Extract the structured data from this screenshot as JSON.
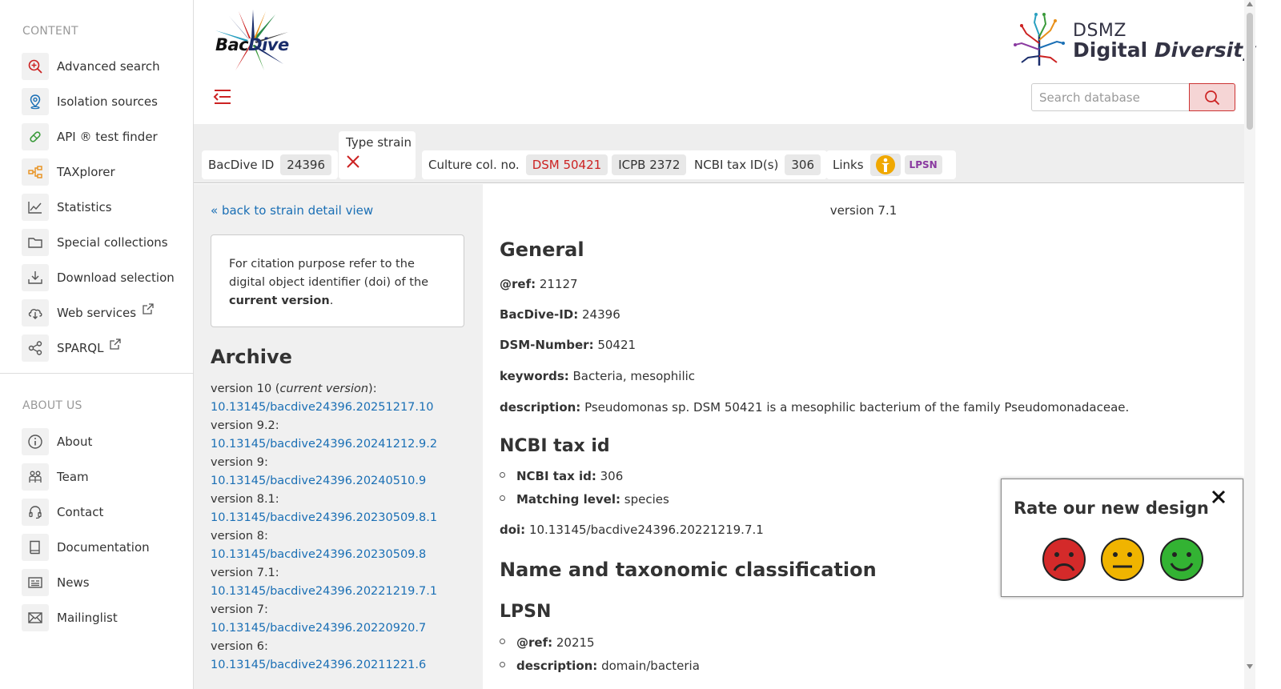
{
  "sidebar": {
    "content_title": "CONTENT",
    "content_items": [
      {
        "label": "Advanced search",
        "icon": "zoom-in-icon"
      },
      {
        "label": "Isolation sources",
        "icon": "location-pin-icon"
      },
      {
        "label": "API ® test finder",
        "icon": "test-strip-icon"
      },
      {
        "label": "TAXplorer",
        "icon": "hierarchy-icon"
      },
      {
        "label": "Statistics",
        "icon": "line-chart-icon"
      },
      {
        "label": "Special collections",
        "icon": "folder-icon"
      },
      {
        "label": "Download selection",
        "icon": "download-icon"
      },
      {
        "label": "Web services",
        "icon": "cloud-download-icon",
        "external": true
      },
      {
        "label": "SPARQL",
        "icon": "share-nodes-icon",
        "external": true
      }
    ],
    "about_title": "ABOUT US",
    "about_items": [
      {
        "label": "About",
        "icon": "info-icon"
      },
      {
        "label": "Team",
        "icon": "team-icon"
      },
      {
        "label": "Contact",
        "icon": "headset-icon"
      },
      {
        "label": "Documentation",
        "icon": "book-icon"
      },
      {
        "label": "News",
        "icon": "newspaper-icon"
      },
      {
        "label": "Mailinglist",
        "icon": "envelope-icon"
      }
    ]
  },
  "header": {
    "logo_left": "Bac",
    "logo_right": "Dive",
    "dsmz_top": "DSMZ",
    "dsmz_bottom_a": "Digital ",
    "dsmz_bottom_b": "Diversity",
    "search_placeholder": "Search database"
  },
  "infobar": {
    "bacdive_id_label": "BacDive ID",
    "bacdive_id": "24396",
    "type_strain_label": "Type strain",
    "culture_label": "Culture col. no.",
    "culture_nos": [
      "DSM 50421",
      "ICPB 2372"
    ],
    "ncbi_label": "NCBI tax ID(s)",
    "ncbi_id": "306",
    "links_label": "Links",
    "lpsn_badge": "LPSN"
  },
  "left": {
    "back_link": "« back to strain detail view",
    "cite_text_a": "For citation purpose refer to the digital object identifier (doi) of the ",
    "cite_bold": "current version",
    "cite_text_b": ".",
    "archive_title": "Archive",
    "archive": [
      {
        "version": "version 10 (",
        "current": "current version",
        "tail": "):",
        "doi": "10.13145/bacdive24396.20251217.10"
      },
      {
        "version": "version 9.2:",
        "doi": "10.13145/bacdive24396.20241212.9.2"
      },
      {
        "version": "version 9:",
        "doi": "10.13145/bacdive24396.20240510.9"
      },
      {
        "version": "version 8.1:",
        "doi": "10.13145/bacdive24396.20230509.8.1"
      },
      {
        "version": "version 8:",
        "doi": "10.13145/bacdive24396.20230509.8"
      },
      {
        "version": "version 7.1:",
        "doi": "10.13145/bacdive24396.20221219.7.1"
      },
      {
        "version": "version 7:",
        "doi": "10.13145/bacdive24396.20220920.7"
      },
      {
        "version": "version 6:",
        "doi": "10.13145/bacdive24396.20211221.6"
      }
    ]
  },
  "main": {
    "version_label": "version 7.1",
    "general_title": "General",
    "ref_label": "@ref:",
    "ref_val": " 21127",
    "bacdive_label": "BacDive-ID:",
    "bacdive_val": " 24396",
    "dsm_label": "DSM-Number:",
    "dsm_val": " 50421",
    "keywords_label": "keywords:",
    "keywords_val": " Bacteria, mesophilic",
    "description_label": "description:",
    "description_val": " Pseudomonas sp. DSM 50421 is a mesophilic bacterium of the family Pseudomonadaceae.",
    "ncbi_title": "NCBI tax id",
    "ncbi_tax_label": "NCBI tax id:",
    "ncbi_tax_val": " 306",
    "matching_label": "Matching level:",
    "matching_val": " species",
    "doi_label": "doi:",
    "doi_val": " 10.13145/bacdive24396.20221219.7.1",
    "name_title": "Name and taxonomic classification",
    "lpsn_title": "LPSN",
    "lpsn_ref_label": "@ref:",
    "lpsn_ref_val": " 20215",
    "lpsn_desc_label": "description:",
    "lpsn_desc_val": " domain/bacteria"
  },
  "rating": {
    "title": "Rate our new design",
    "faces": [
      "sad-face-icon",
      "neutral-face-icon",
      "happy-face-icon"
    ],
    "colors": {
      "sad": "#d42a2a",
      "neutral": "#f0b400",
      "happy": "#33b333"
    }
  },
  "colors": {
    "accent_red": "#c22222",
    "link_blue": "#1a6fb5"
  }
}
